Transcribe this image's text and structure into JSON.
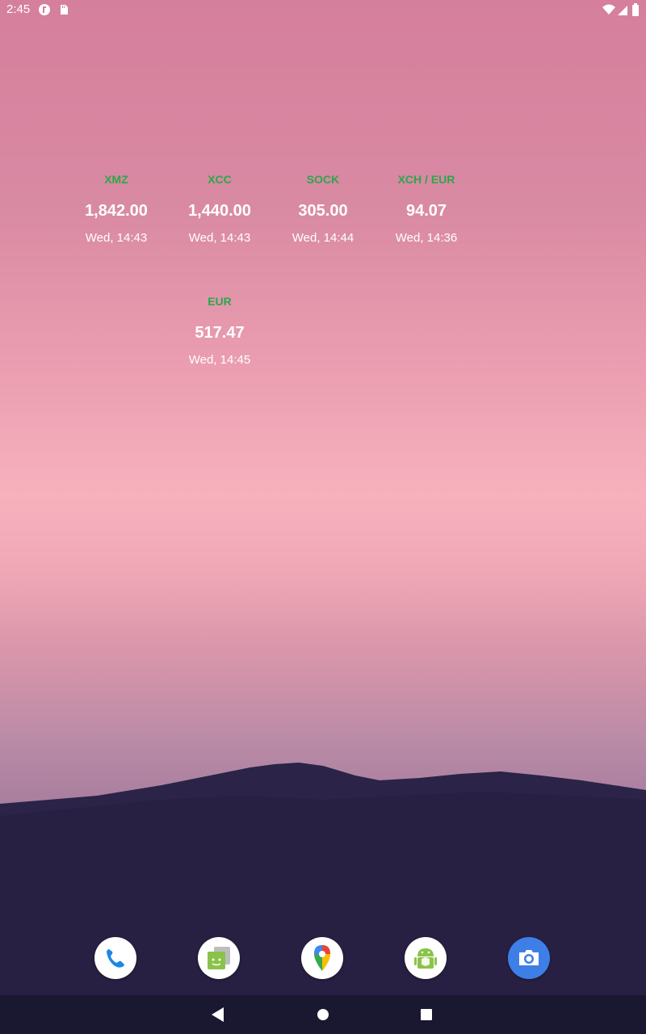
{
  "status_bar": {
    "time": "2:45",
    "left_icons": [
      "app-notification-icon",
      "sd-card-icon"
    ],
    "right_icons": [
      "wifi-icon",
      "signal-icon",
      "battery-icon"
    ]
  },
  "widgets": [
    {
      "symbol": "XMZ",
      "value": "1,842.00",
      "time": "Wed, 14:43"
    },
    {
      "symbol": "XCC",
      "value": "1,440.00",
      "time": "Wed, 14:43"
    },
    {
      "symbol": "SOCK",
      "value": "305.00",
      "time": "Wed, 14:44"
    },
    {
      "symbol": "XCH / EUR",
      "value": "94.07",
      "time": "Wed, 14:36"
    },
    {
      "symbol": "EUR",
      "value": "517.47",
      "time": "Wed, 14:45"
    }
  ],
  "dock": {
    "apps": [
      "phone-icon",
      "messages-icon",
      "maps-icon",
      "android-app-icon",
      "camera-icon"
    ]
  },
  "nav_bar": {
    "buttons": [
      "back-icon",
      "home-icon",
      "recents-icon"
    ]
  },
  "colors": {
    "symbol_green": "#2aa84a",
    "camera_blue": "#3d7fe6",
    "phone_blue": "#1a88e6"
  }
}
